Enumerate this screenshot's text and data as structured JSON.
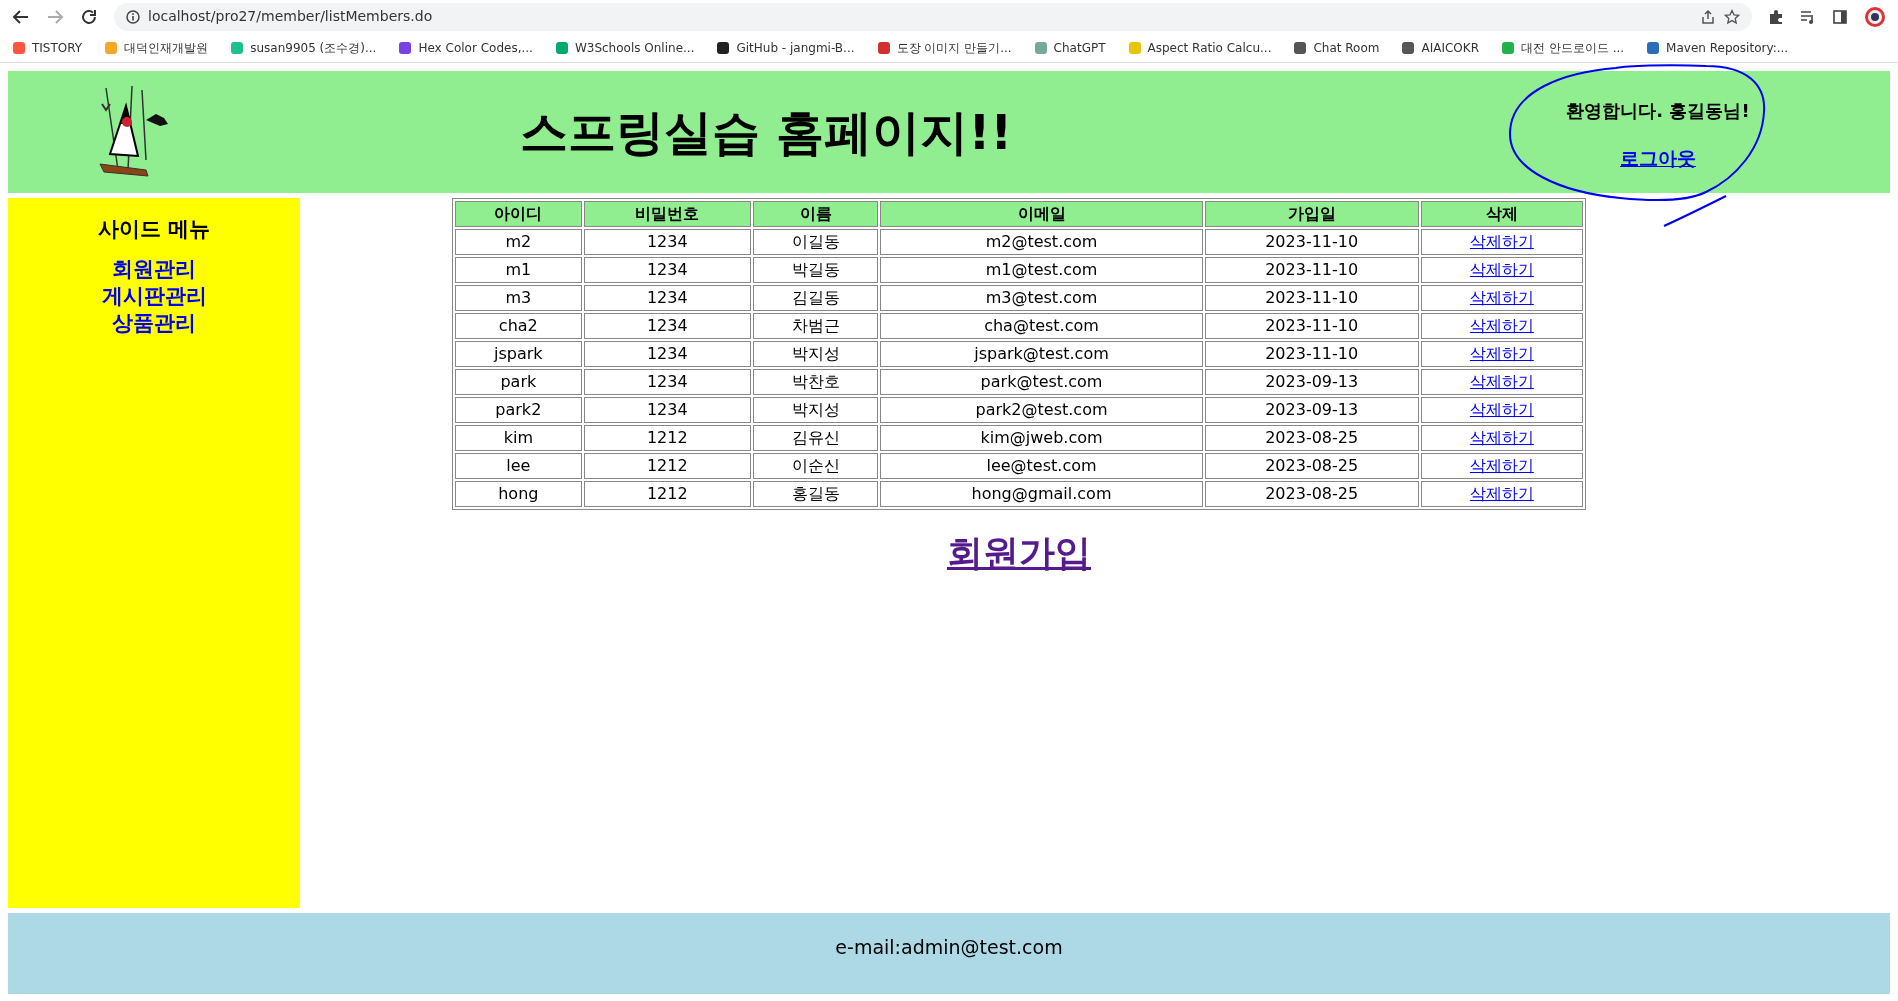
{
  "browser": {
    "url": "localhost/pro27/member/listMembers.do",
    "bookmarks": [
      {
        "label": "TISTORY",
        "color": "#ff5544"
      },
      {
        "label": "대덕인재개발원",
        "color": "#f5a623"
      },
      {
        "label": "susan9905 (조수경)...",
        "color": "#1fbf8f"
      },
      {
        "label": "Hex Color Codes,...",
        "color": "#7b3fe4"
      },
      {
        "label": "W3Schools Online...",
        "color": "#04aa6d"
      },
      {
        "label": "GitHub - jangmi-B...",
        "color": "#222222"
      },
      {
        "label": "도장 이미지 만들기...",
        "color": "#d03030"
      },
      {
        "label": "ChatGPT",
        "color": "#74aa9c"
      },
      {
        "label": "Aspect Ratio Calcu...",
        "color": "#e8c400"
      },
      {
        "label": "Chat Room",
        "color": "#555555"
      },
      {
        "label": "AIAICOKR",
        "color": "#555555"
      },
      {
        "label": "대전 안드로이드 ...",
        "color": "#22b14c"
      },
      {
        "label": "Maven Repository:...",
        "color": "#2a6ebb"
      }
    ]
  },
  "header": {
    "title": "스프링실습 홈페이지!!",
    "welcome": "환영합니다. 홍길동님!",
    "logout": "로그아웃"
  },
  "sidebar": {
    "title": "사이드 메뉴",
    "items": [
      "회원관리",
      "게시판관리",
      "상품관리"
    ]
  },
  "table": {
    "columns": [
      "아이디",
      "비밀번호",
      "이름",
      "이메일",
      "가입일",
      "삭제"
    ],
    "rows": [
      [
        "m2",
        "1234",
        "이길동",
        "m2@test.com",
        "2023-11-10",
        "삭제하기"
      ],
      [
        "m1",
        "1234",
        "박길동",
        "m1@test.com",
        "2023-11-10",
        "삭제하기"
      ],
      [
        "m3",
        "1234",
        "김길동",
        "m3@test.com",
        "2023-11-10",
        "삭제하기"
      ],
      [
        "cha2",
        "1234",
        "차범근",
        "cha@test.com",
        "2023-11-10",
        "삭제하기"
      ],
      [
        "jspark",
        "1234",
        "박지성",
        "jspark@test.com",
        "2023-11-10",
        "삭제하기"
      ],
      [
        "park",
        "1234",
        "박찬호",
        "park@test.com",
        "2023-09-13",
        "삭제하기"
      ],
      [
        "park2",
        "1234",
        "박지성",
        "park2@test.com",
        "2023-09-13",
        "삭제하기"
      ],
      [
        "kim",
        "1212",
        "김유신",
        "kim@jweb.com",
        "2023-08-25",
        "삭제하기"
      ],
      [
        "lee",
        "1212",
        "이순신",
        "lee@test.com",
        "2023-08-25",
        "삭제하기"
      ],
      [
        "hong",
        "1212",
        "홍길동",
        "hong@gmail.com",
        "2023-08-25",
        "삭제하기"
      ]
    ]
  },
  "join_link": "회원가입",
  "footer": {
    "email": "e-mail:admin@test.com"
  }
}
